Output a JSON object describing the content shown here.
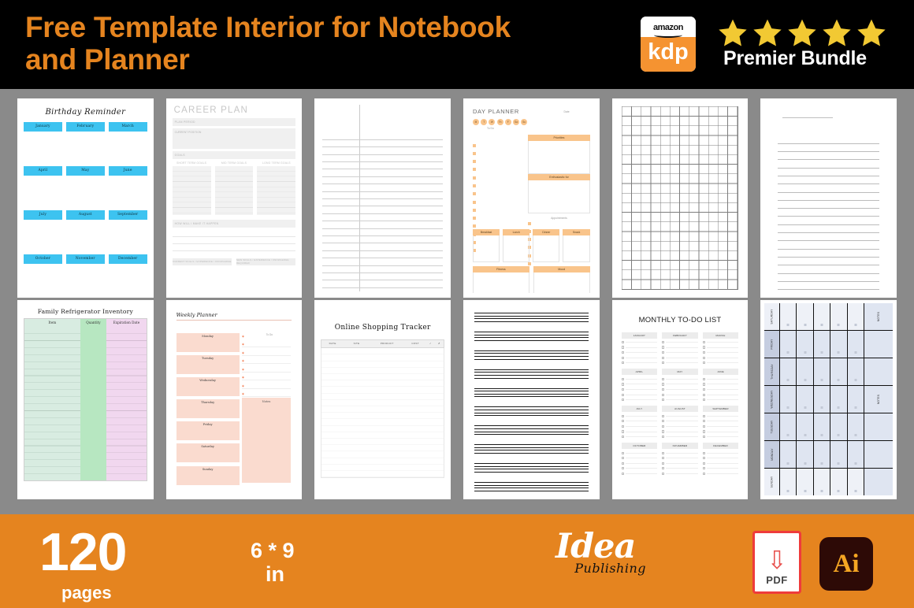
{
  "header": {
    "title": "Free Template Interior for Notebook and Planner",
    "kdp_amazon_label": "amazon",
    "kdp_label": "kdp",
    "stars": 5,
    "star_color": "#f2c933",
    "bundle_label": "Premier Bundle",
    "background": "#000000",
    "title_color": "#e5841f"
  },
  "footer": {
    "page_count": "120",
    "pages_label": "pages",
    "size_line1": "6 * 9",
    "size_line2": "in",
    "brand_name": "Idea",
    "brand_sub": "Publishing",
    "pdf_badge": "PDF",
    "ai_badge": "Ai",
    "background": "#e5841f"
  },
  "templates": [
    {
      "id": "birthday-reminder",
      "type": "birthday",
      "title": "Birthday Reminder",
      "chip_color": "#3dc3f0",
      "months": [
        "January",
        "February",
        "March",
        "April",
        "May",
        "June",
        "July",
        "August",
        "September",
        "October",
        "November",
        "December"
      ]
    },
    {
      "id": "career-plan",
      "type": "career",
      "title": "CAREER PLAN",
      "fields": [
        "PLAN PERIOD",
        "CURRENT POSITION",
        "GOALS"
      ],
      "columns": [
        "SHORT TERM GOALS",
        "MID TERM GOALS",
        "LONG TERM GOALS"
      ],
      "sub_field": "HOW WILL I MAKE IT HAPPEN",
      "buttons": [
        "CURRENT SKILLS / EXPERIENCE / KNOWLEDGE",
        "NEW SKILLS / EXPERIENCE / KNOWLEDGE REQUIRED"
      ]
    },
    {
      "id": "cornell-notes",
      "type": "cornell",
      "title": "",
      "line_count": 22
    },
    {
      "id": "day-planner",
      "type": "dayplanner",
      "title": "DAY PLANNER",
      "date_label": "Date",
      "days": [
        "M",
        "T",
        "W",
        "Th",
        "F",
        "Sa",
        "Su"
      ],
      "todo_label": "To Do",
      "priorities_label": "Priorities",
      "enthusiastic_label": "Enthusiastic for",
      "appointments_label": "Appointments",
      "meals": [
        "Breakfast",
        "Lunch",
        "Dinner",
        "Snack"
      ],
      "bottom": [
        "Fitness",
        "Mood"
      ],
      "accent_color": "#f9c48b"
    },
    {
      "id": "graph-paper",
      "type": "graph",
      "title": "",
      "cols": 12,
      "rows": 20
    },
    {
      "id": "lined-paper",
      "type": "lined",
      "title": "",
      "line_count": 20
    },
    {
      "id": "refrigerator-inventory",
      "type": "inventory",
      "title": "Family Refrigerator Inventory",
      "columns": [
        "Item",
        "Quantity",
        "Expiration Date"
      ],
      "column_colors": [
        "#d8ece1",
        "#b7e7c1",
        "#f1d7ef"
      ]
    },
    {
      "id": "weekly-planner",
      "type": "weekly-pink",
      "title": "Weekly Planner",
      "days": [
        "Monday",
        "Tuesday",
        "Wednesday",
        "Thursday",
        "Friday",
        "Saturday",
        "Sunday"
      ],
      "notes_label": "Notes",
      "todo_label": "To Do",
      "accent_color": "#fadbcf"
    },
    {
      "id": "online-shopping-tracker",
      "type": "tracker",
      "title": "Online Shopping Tracker",
      "columns": [
        "DATE",
        "SITE",
        "PRODUCT",
        "COST",
        "✓",
        "✗"
      ]
    },
    {
      "id": "handwriting-practice",
      "type": "handwriting",
      "title": "",
      "group_count": 10
    },
    {
      "id": "monthly-todo-list",
      "type": "monthly-todo",
      "title": "MONTHLY TO-DO LIST",
      "months": [
        "JANUARY",
        "FEBRUARY",
        "MARCH",
        "APRIL",
        "MAY",
        "JUNE",
        "JULY",
        "AUGUST",
        "SEPTEMBER",
        "OCTOBER",
        "NOVEMBER",
        "DECEMBER"
      ],
      "rows_per_month": 5
    },
    {
      "id": "weekly-grid-rotated",
      "type": "weekly-grid",
      "title": "",
      "days": [
        "SATURDAY",
        "FRIDAY",
        "THURSDAY",
        "WEDNESDAY",
        "TUESDAY",
        "MONDAY",
        "SUNDAY"
      ],
      "notes_label": "NOTES",
      "columns_per_day": 5
    }
  ]
}
